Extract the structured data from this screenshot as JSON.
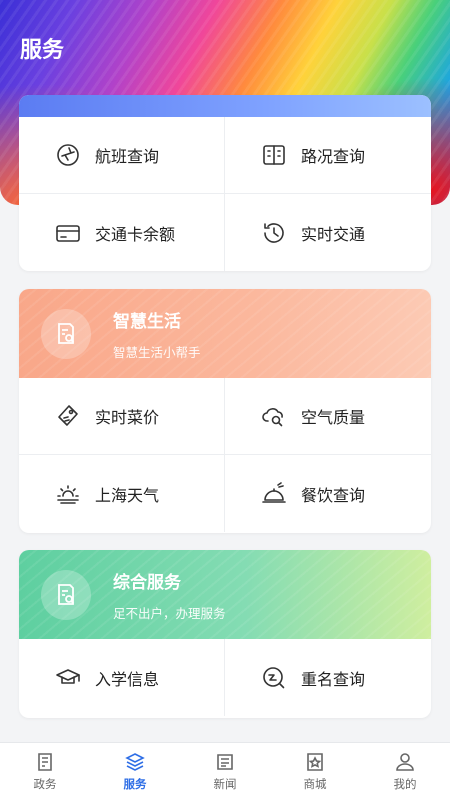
{
  "header": {
    "title": "服务"
  },
  "traffic": {
    "items": [
      {
        "label": "航班查询",
        "icon": "flight-icon"
      },
      {
        "label": "路况查询",
        "icon": "road-icon"
      },
      {
        "label": "交通卡余额",
        "icon": "card-icon"
      },
      {
        "label": "实时交通",
        "icon": "history-icon"
      }
    ]
  },
  "life": {
    "title": "智慧生活",
    "subtitle": "智慧生活小帮手",
    "items": [
      {
        "label": "实时菜价",
        "icon": "price-tag-icon"
      },
      {
        "label": "空气质量",
        "icon": "cloud-search-icon"
      },
      {
        "label": "上海天气",
        "icon": "weather-icon"
      },
      {
        "label": "餐饮查询",
        "icon": "dining-icon"
      }
    ]
  },
  "service": {
    "title": "综合服务",
    "subtitle": "足不出户，办理服务",
    "items": [
      {
        "label": "入学信息",
        "icon": "graduation-cap-icon"
      },
      {
        "label": "重名查询",
        "icon": "name-search-icon"
      }
    ]
  },
  "tabbar": {
    "active": "服务",
    "accent": "#2e6ee6",
    "tabs": [
      {
        "label": "政务"
      },
      {
        "label": "服务"
      },
      {
        "label": "新闻"
      },
      {
        "label": "商城"
      },
      {
        "label": "我的"
      }
    ]
  }
}
